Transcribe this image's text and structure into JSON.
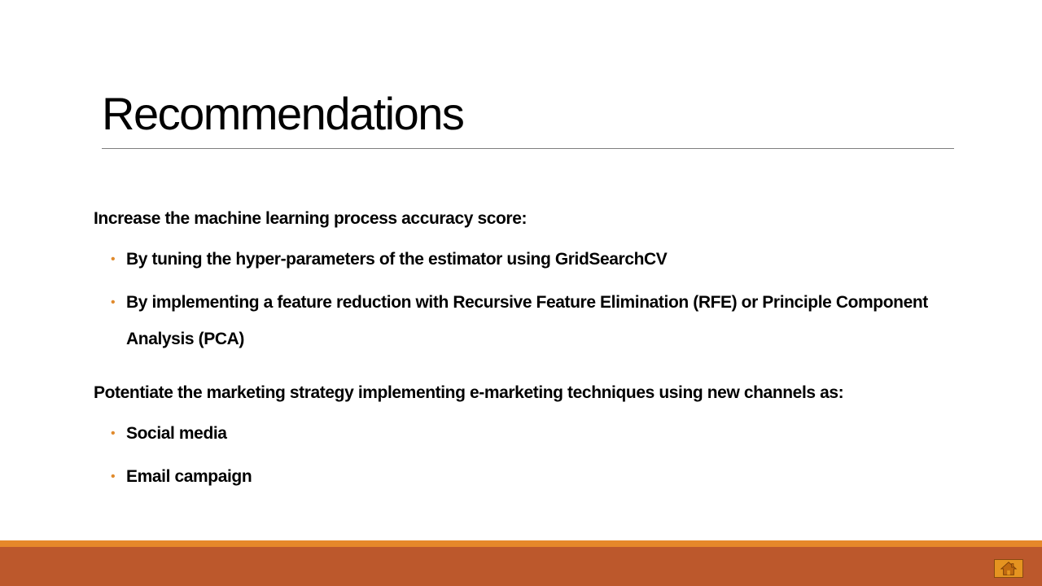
{
  "slide": {
    "title": "Recommendations",
    "sections": [
      {
        "heading": "Increase the machine learning process accuracy score:",
        "bullets": [
          "By tuning the hyper-parameters of the estimator using GridSearchCV",
          "By implementing a feature reduction with Recursive Feature Elimination (RFE) or Principle Component Analysis (PCA)"
        ]
      },
      {
        "heading": "Potentiate the marketing strategy implementing e-marketing techniques using new channels as:",
        "bullets": [
          "Social media",
          "Email campaign"
        ]
      }
    ],
    "bullet_glyph": "•"
  },
  "footer": {
    "home_icon": "home-icon"
  },
  "colors": {
    "accent_orange": "#e6882a",
    "footer_band": "#bc582c",
    "bullet": "#e08a2c",
    "home_button": "#e59420"
  }
}
